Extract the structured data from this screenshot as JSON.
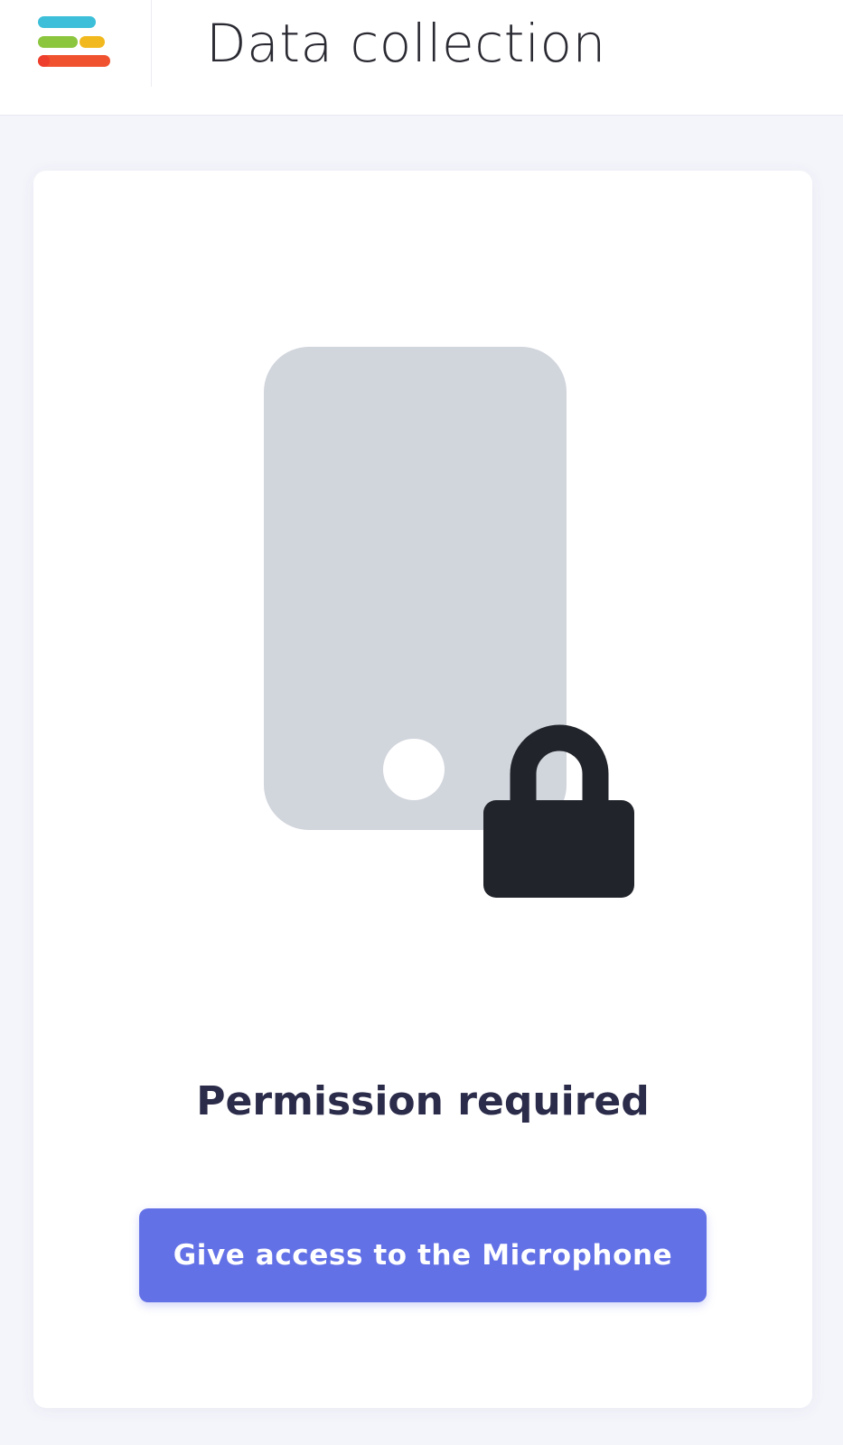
{
  "header": {
    "title": "Data collection",
    "menu_icon": "hamburger-menu-icon",
    "menu_icon_colors": [
      "#3dbfd9",
      "#8cc63f",
      "#f2b91e",
      "#f0522f"
    ]
  },
  "main": {
    "illustration_icon": "locked-phone-icon",
    "permission_title": "Permission required",
    "access_button_label": "Give access to the Microphone"
  },
  "colors": {
    "accent": "#6371e6",
    "page_background": "#f4f5fb",
    "card_background": "#ffffff",
    "phone_gray": "#d1d5dc",
    "lock_dark": "#22242b",
    "title_text": "#2b2b4a"
  }
}
